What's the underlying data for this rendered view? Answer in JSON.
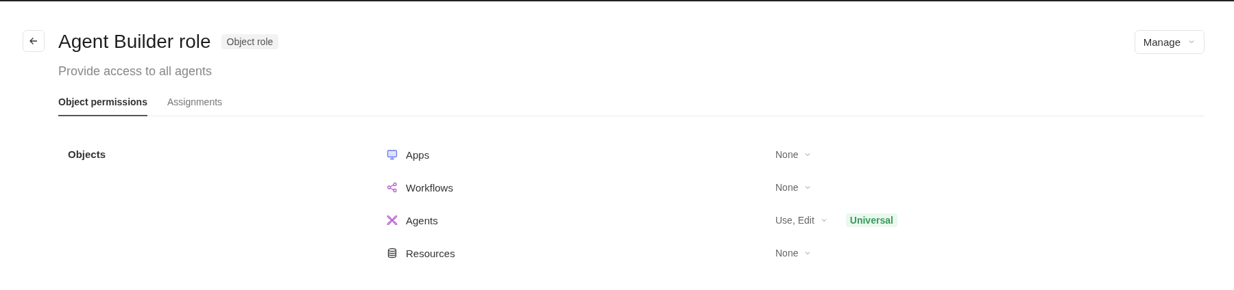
{
  "header": {
    "title": "Agent Builder role",
    "tag": "Object role",
    "subtitle": "Provide access to all agents",
    "manage_button": "Manage"
  },
  "tabs": [
    {
      "label": "Object permissions",
      "selected": true
    },
    {
      "label": "Assignments",
      "selected": false
    }
  ],
  "section": {
    "heading": "Objects",
    "rows": [
      {
        "kind": "monitor",
        "name": "Apps",
        "access": "None"
      },
      {
        "kind": "share",
        "name": "Workflows",
        "access": "None"
      },
      {
        "kind": "petals",
        "name": "Agents",
        "access": "Use, Edit",
        "badge": "Universal"
      },
      {
        "kind": "database",
        "name": "Resources",
        "access": "None"
      }
    ]
  }
}
